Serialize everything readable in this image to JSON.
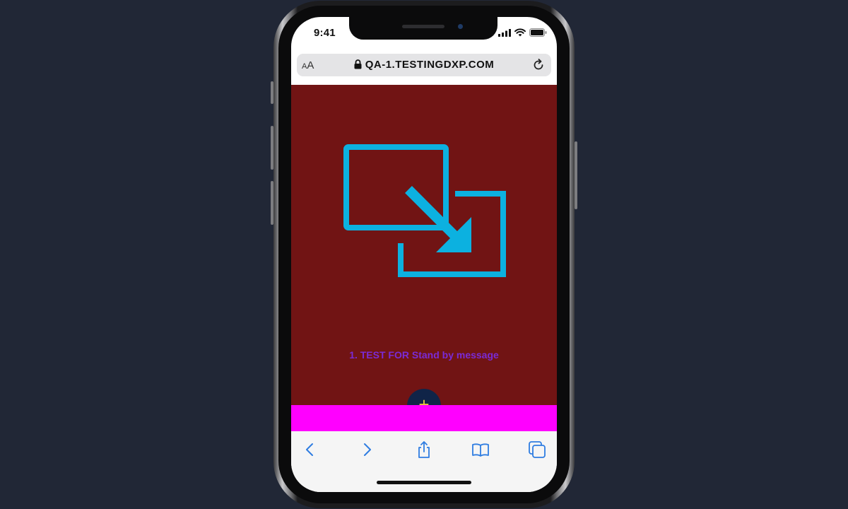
{
  "status_bar": {
    "time": "9:41"
  },
  "browser": {
    "text_size_label_small": "A",
    "text_size_label_large": "A",
    "url": "QA-1.TESTINGDXP.COM"
  },
  "page": {
    "background_color": "#711414",
    "icon_color": "#0cb1e0",
    "message": "1. TEST FOR Stand by message",
    "fab_label": "+",
    "banner_color": "#ff00ff"
  },
  "toolbar": {
    "items": [
      "back",
      "forward",
      "share",
      "bookmarks",
      "tabs"
    ]
  }
}
